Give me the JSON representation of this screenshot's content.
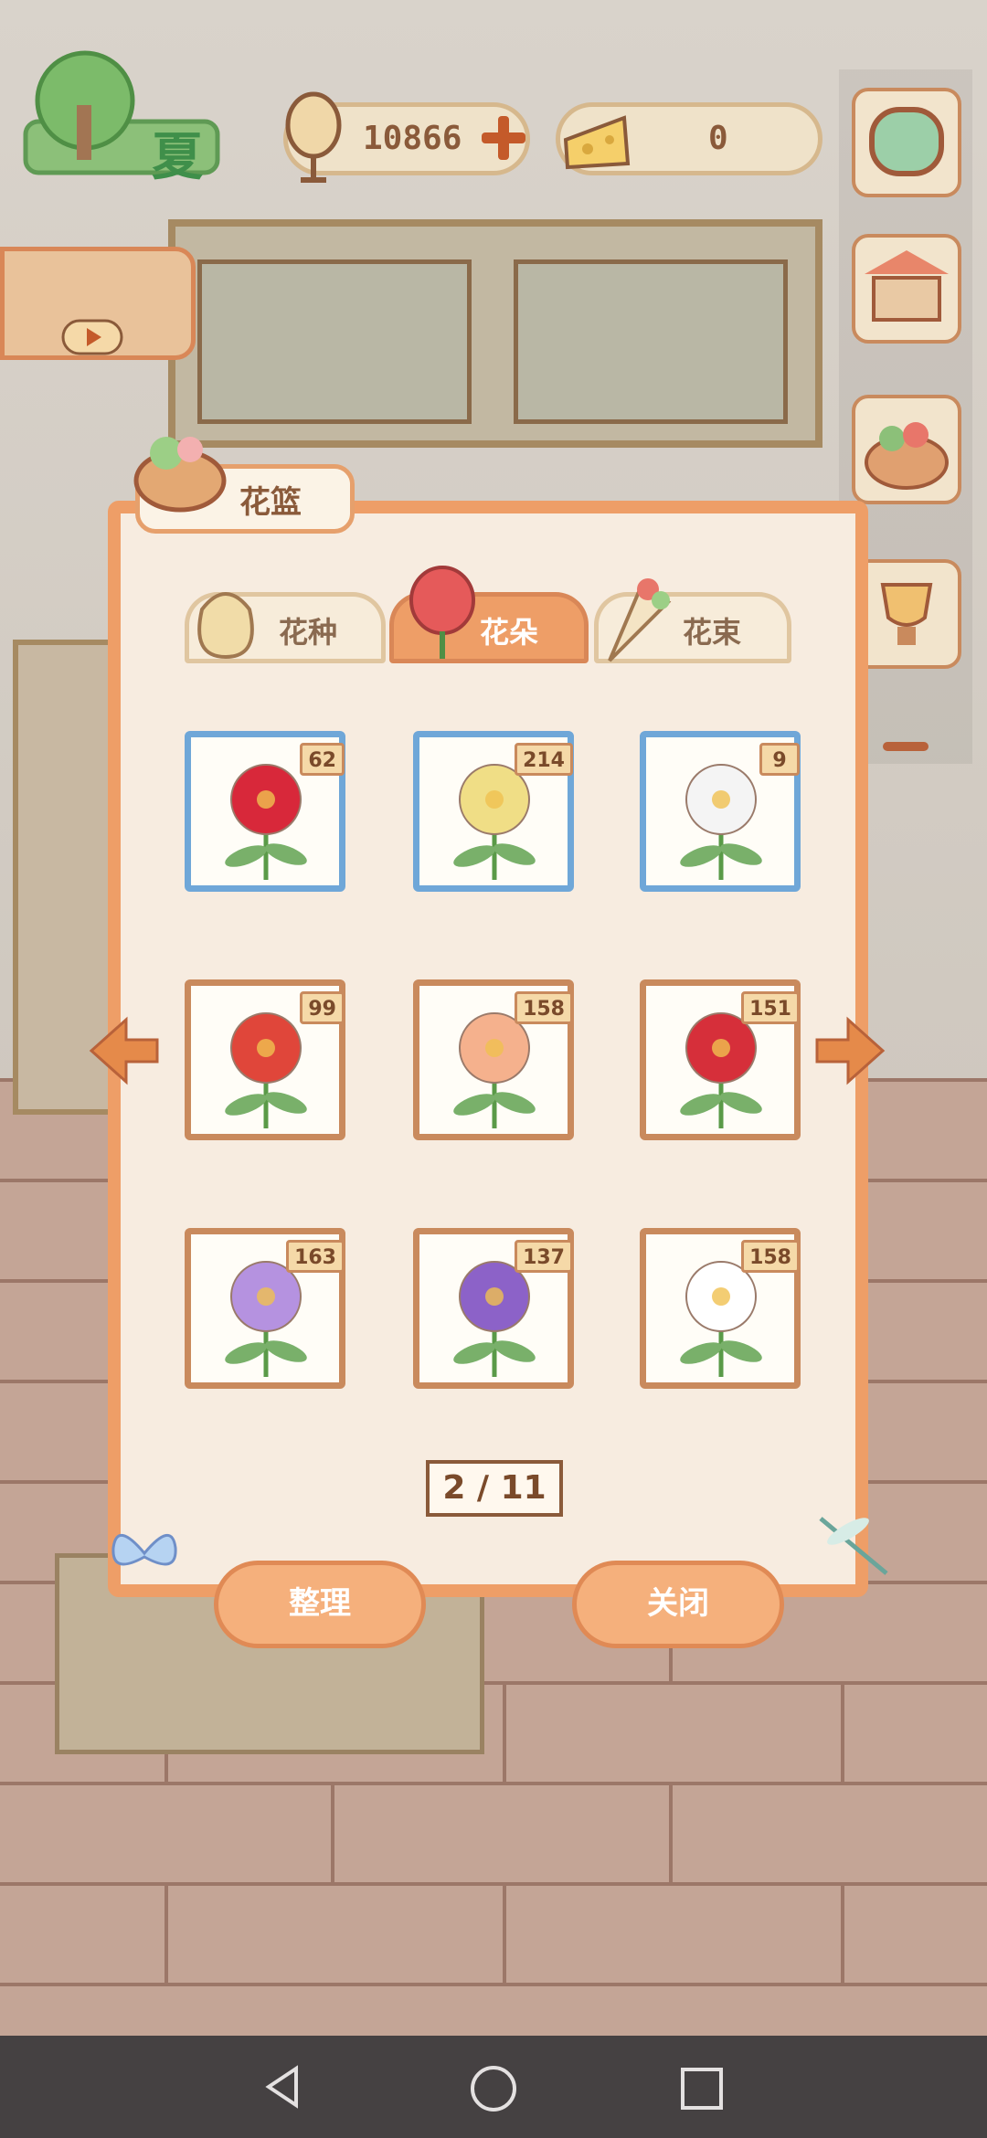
{
  "top_bar": {
    "season_label": "夏",
    "coins": "10866",
    "coin_add_icon": "plus-icon",
    "cheese": "0"
  },
  "panel": {
    "title": "花篮",
    "tabs": [
      {
        "label": "花种",
        "icon": "seed-bag-icon"
      },
      {
        "label": "花朵",
        "icon": "flower-icon",
        "active": true
      },
      {
        "label": "花束",
        "icon": "bouquet-icon"
      }
    ],
    "items": [
      {
        "name": "red-spider-lily",
        "count": "62",
        "color": "#d8283a"
      },
      {
        "name": "yellow-hydrangea",
        "count": "214",
        "color": "#f0de86"
      },
      {
        "name": "white-hydrangea",
        "count": "9",
        "color": "#f4f4f4"
      },
      {
        "name": "red-nerine",
        "count": "99",
        "color": "#e0463a"
      },
      {
        "name": "peach-rose",
        "count": "158",
        "color": "#f5b18d"
      },
      {
        "name": "red-rose",
        "count": "151",
        "color": "#d62f3a"
      },
      {
        "name": "purple-hyacinth",
        "count": "163",
        "color": "#b592e0"
      },
      {
        "name": "pansy",
        "count": "137",
        "color": "#8c62c8"
      },
      {
        "name": "daisy",
        "count": "158",
        "color": "#ffffff"
      }
    ],
    "pager": "2 / 11",
    "sort_label": "整理",
    "close_label": "关闭"
  }
}
